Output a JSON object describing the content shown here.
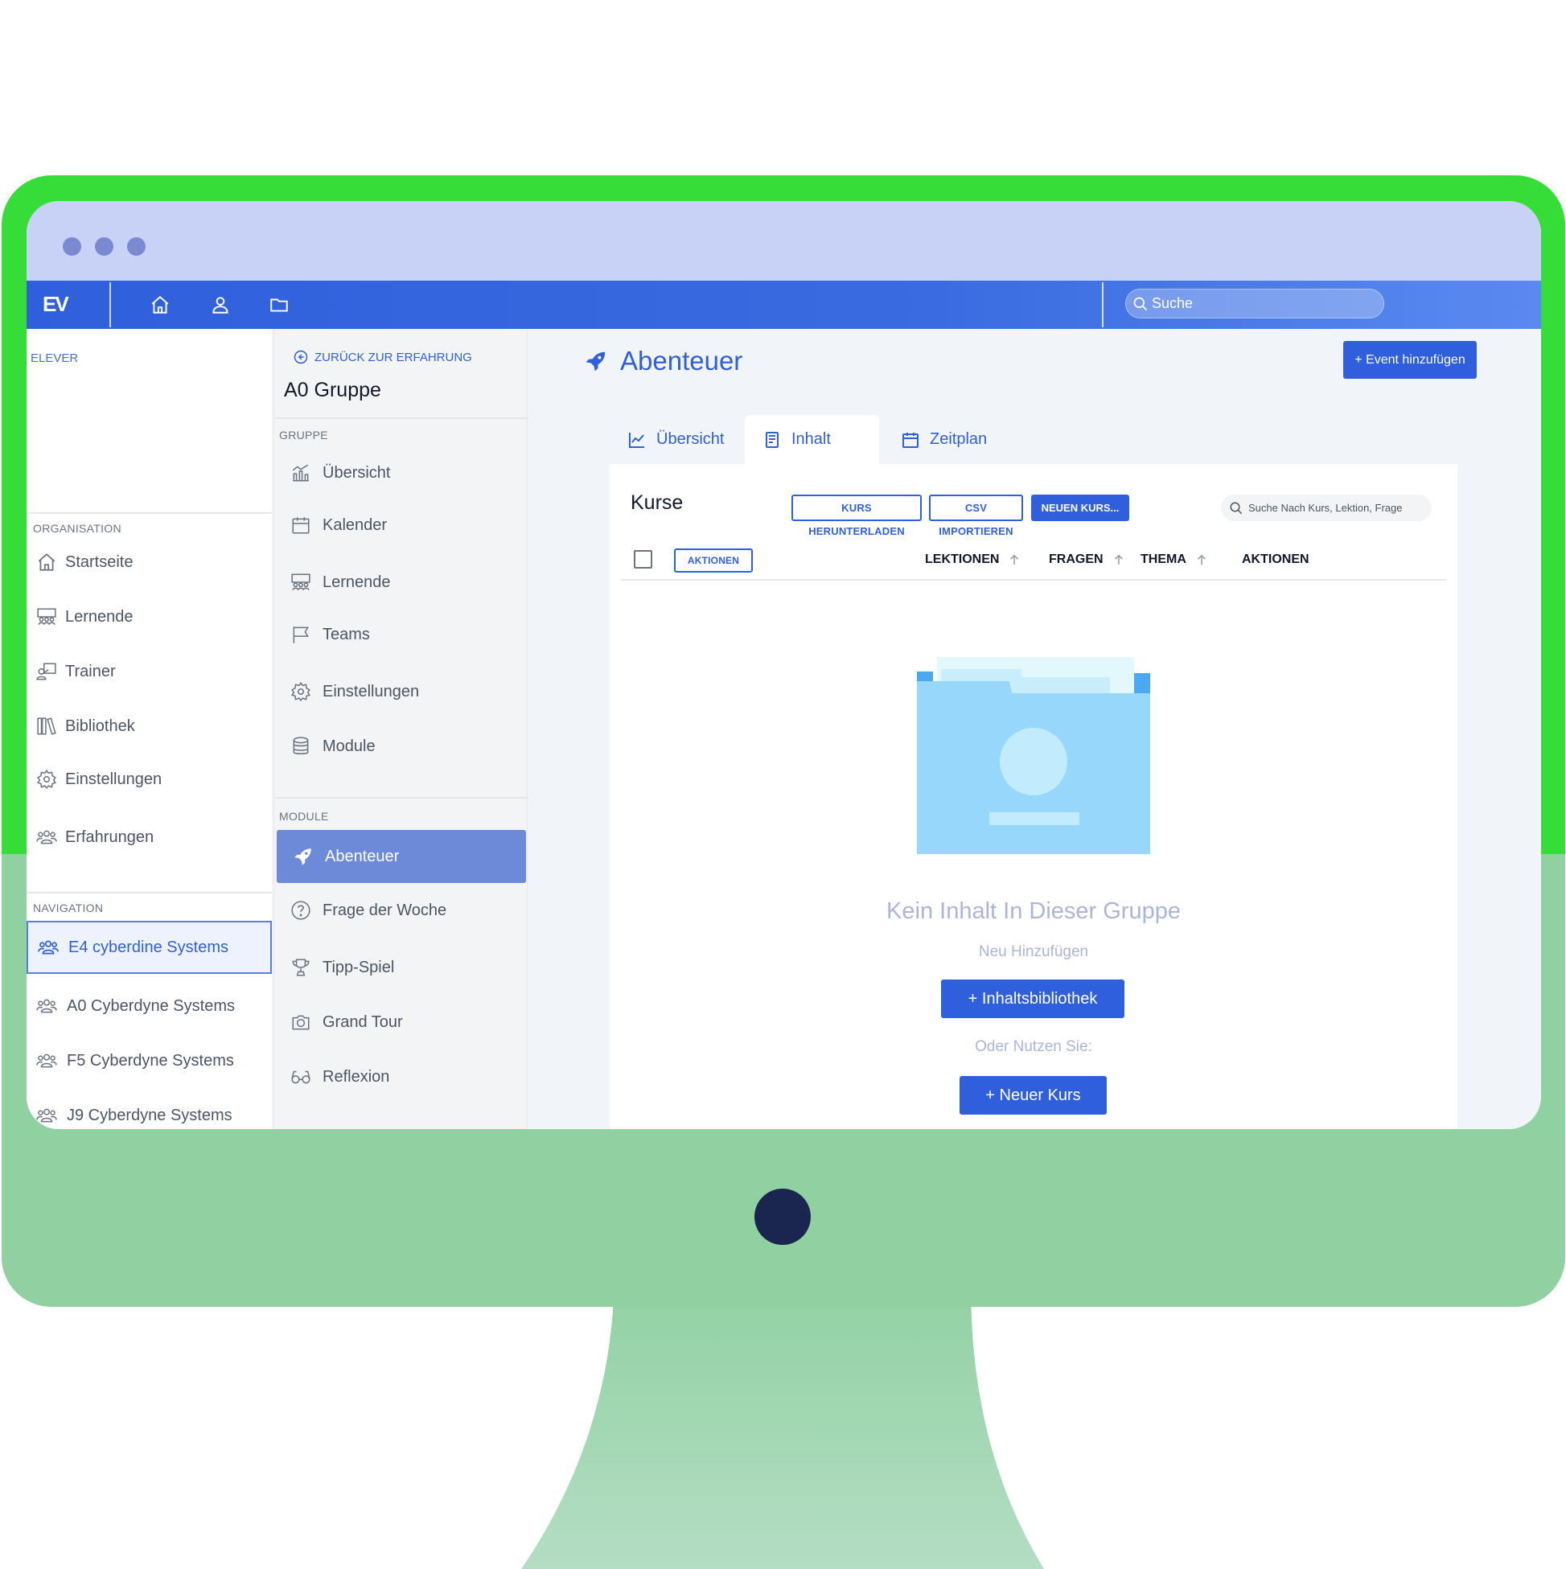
{
  "topbar": {
    "logo": "EV",
    "search_placeholder": "Suche"
  },
  "sidebar": {
    "brand": "ELEVER",
    "organisation_label": "ORGANISATION",
    "items": [
      {
        "label": "Startseite",
        "icon": "home-icon"
      },
      {
        "label": "Lernende",
        "icon": "learners-icon"
      },
      {
        "label": "Trainer",
        "icon": "trainer-icon"
      },
      {
        "label": "Bibliothek",
        "icon": "library-icon"
      },
      {
        "label": "Einstellungen",
        "icon": "gear-icon"
      },
      {
        "label": "Erfahrungen",
        "icon": "users-icon"
      }
    ],
    "navigation_label": "NAVIGATION",
    "groups": [
      {
        "label": "E4 cyberdine Systems",
        "active": true
      },
      {
        "label": "A0 Cyberdyne Systems"
      },
      {
        "label": "F5 Cyberdyne Systems"
      },
      {
        "label": "J9 Cyberdyne Systems"
      }
    ]
  },
  "group_sidebar": {
    "back_label": "ZURÜCK ZUR ERFAHRUNG",
    "title": "A0 Gruppe",
    "gruppe_label": "GRUPPE",
    "gruppe_items": [
      {
        "label": "Übersicht",
        "icon": "chart-icon"
      },
      {
        "label": "Kalender",
        "icon": "calendar-icon"
      },
      {
        "label": "Lernende",
        "icon": "learners-icon"
      },
      {
        "label": "Teams",
        "icon": "flag-icon"
      },
      {
        "label": "Einstellungen",
        "icon": "gear-icon"
      },
      {
        "label": "Module",
        "icon": "database-icon"
      }
    ],
    "module_label": "MODULE",
    "module_items": [
      {
        "label": "Abenteuer",
        "icon": "rocket-icon",
        "active": true
      },
      {
        "label": "Frage der Woche",
        "icon": "question-icon"
      },
      {
        "label": "Tipp-Spiel",
        "icon": "trophy-icon"
      },
      {
        "label": "Grand Tour",
        "icon": "camera-icon"
      },
      {
        "label": "Reflexion",
        "icon": "glasses-icon"
      }
    ]
  },
  "main": {
    "title": "Abenteuer",
    "event_button": "+ Event hinzufügen",
    "tabs": [
      {
        "label": "Übersicht",
        "icon": "trend-icon"
      },
      {
        "label": "Inhalt",
        "icon": "book-icon",
        "active": true
      },
      {
        "label": "Zeitplan",
        "icon": "calendar-icon"
      }
    ],
    "panel": {
      "title": "Kurse",
      "download_button": "KURS HERUNTERLADEN",
      "csv_button": "CSV IMPORTIEREN",
      "new_button": "NEUEN KURS...",
      "search_placeholder": "Suche Nach Kurs, Lektion, Frage",
      "actions_button": "AKTIONEN",
      "columns": [
        "LEKTIONEN",
        "FRAGEN",
        "THEMA",
        "AKTIONEN"
      ],
      "empty_title": "Kein Inhalt In Dieser Gruppe",
      "empty_subtitle": "Neu Hinzufügen",
      "library_button": "+ Inhaltsbibliothek",
      "or_text": "Oder Nutzen Sie:",
      "new_course_button": "+ Neuer Kurs"
    }
  },
  "colors": {
    "accent": "#2f5fdc",
    "monitor_frame": "#36dd38",
    "monitor_base": "#91d1a1"
  }
}
